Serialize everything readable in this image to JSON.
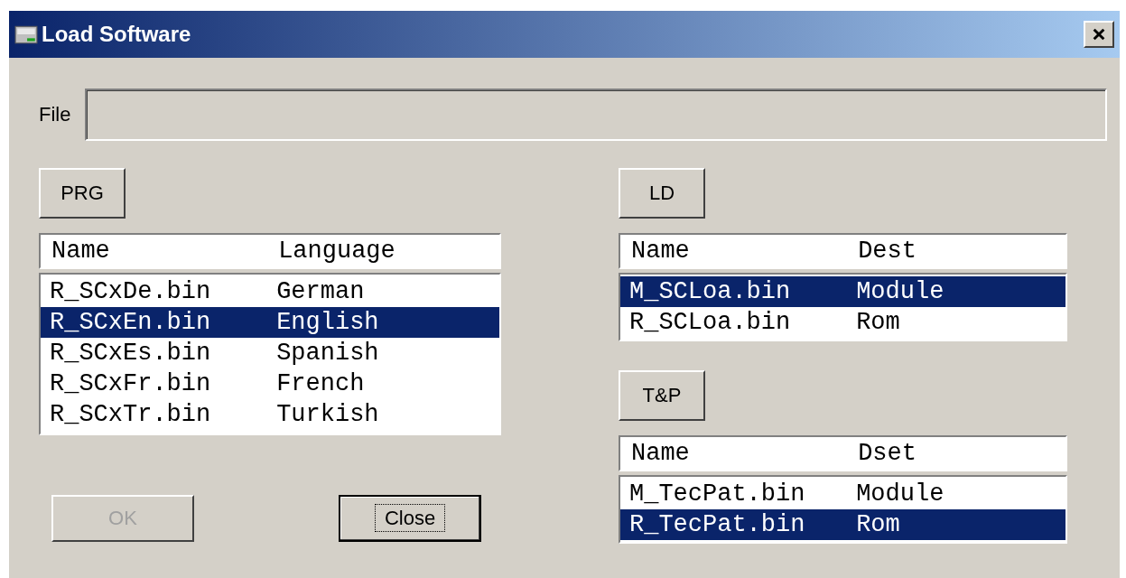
{
  "window": {
    "title": "Load Software"
  },
  "file": {
    "label": "File"
  },
  "prg": {
    "button": "PRG",
    "columns": [
      "Name",
      "Language"
    ],
    "rows": [
      {
        "name": "R_SCxDe.bin",
        "value": "German",
        "selected": false
      },
      {
        "name": "R_SCxEn.bin",
        "value": "English",
        "selected": true
      },
      {
        "name": "R_SCxEs.bin",
        "value": "Spanish",
        "selected": false
      },
      {
        "name": "R_SCxFr.bin",
        "value": "French",
        "selected": false
      },
      {
        "name": "R_SCxTr.bin",
        "value": "Turkish",
        "selected": false
      }
    ]
  },
  "ld": {
    "button": "LD",
    "columns": [
      "Name",
      "Dest"
    ],
    "rows": [
      {
        "name": "M_SCLoa.bin",
        "value": "Module",
        "selected": true
      },
      {
        "name": "R_SCLoa.bin",
        "value": "Rom",
        "selected": false
      }
    ]
  },
  "tp": {
    "button": "T&P",
    "columns": [
      "Name",
      "Dset"
    ],
    "rows": [
      {
        "name": "M_TecPat.bin",
        "value": "Module",
        "selected": false
      },
      {
        "name": "R_TecPat.bin",
        "value": "Rom",
        "selected": true
      }
    ]
  },
  "buttons": [
    {
      "label": "OK",
      "disabled": true,
      "focused": false
    },
    {
      "label": "Close",
      "disabled": false,
      "focused": true
    }
  ]
}
